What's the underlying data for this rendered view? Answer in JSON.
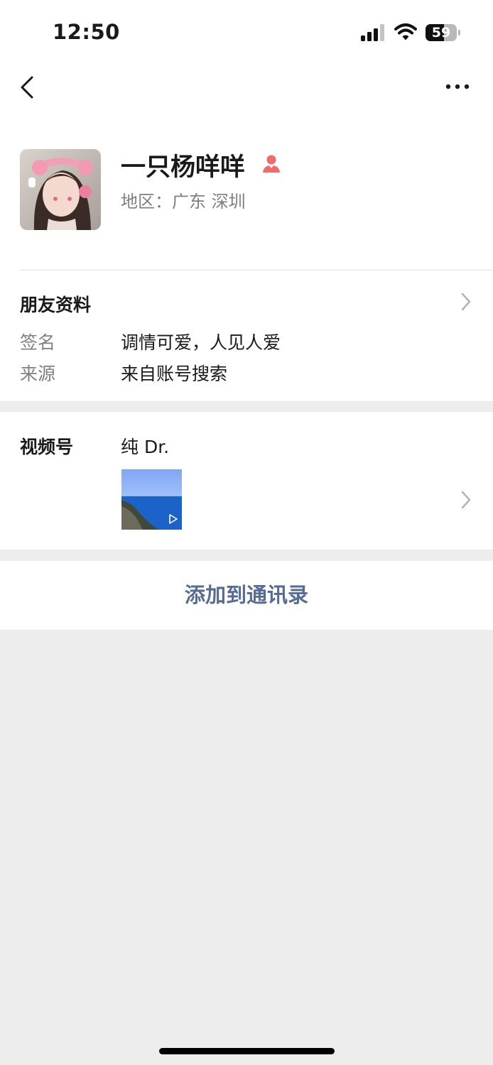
{
  "status_bar": {
    "time": "12:50",
    "battery": "59",
    "battery_level": 0.59
  },
  "profile": {
    "nickname": "一只杨咩咩",
    "region": "地区：广东 深圳",
    "gender_icon": "female-icon",
    "accent_color": "#f26b6b"
  },
  "friend_info": {
    "title": "朋友资料",
    "rows": [
      {
        "label": "签名",
        "value": "调情可爱，人见人爱"
      },
      {
        "label": "来源",
        "value": "来自账号搜索"
      }
    ]
  },
  "channels": {
    "label": "视频号",
    "name": "纯 Dr."
  },
  "actions": {
    "add_contact": "添加到通讯录",
    "link_color": "#576b95"
  }
}
